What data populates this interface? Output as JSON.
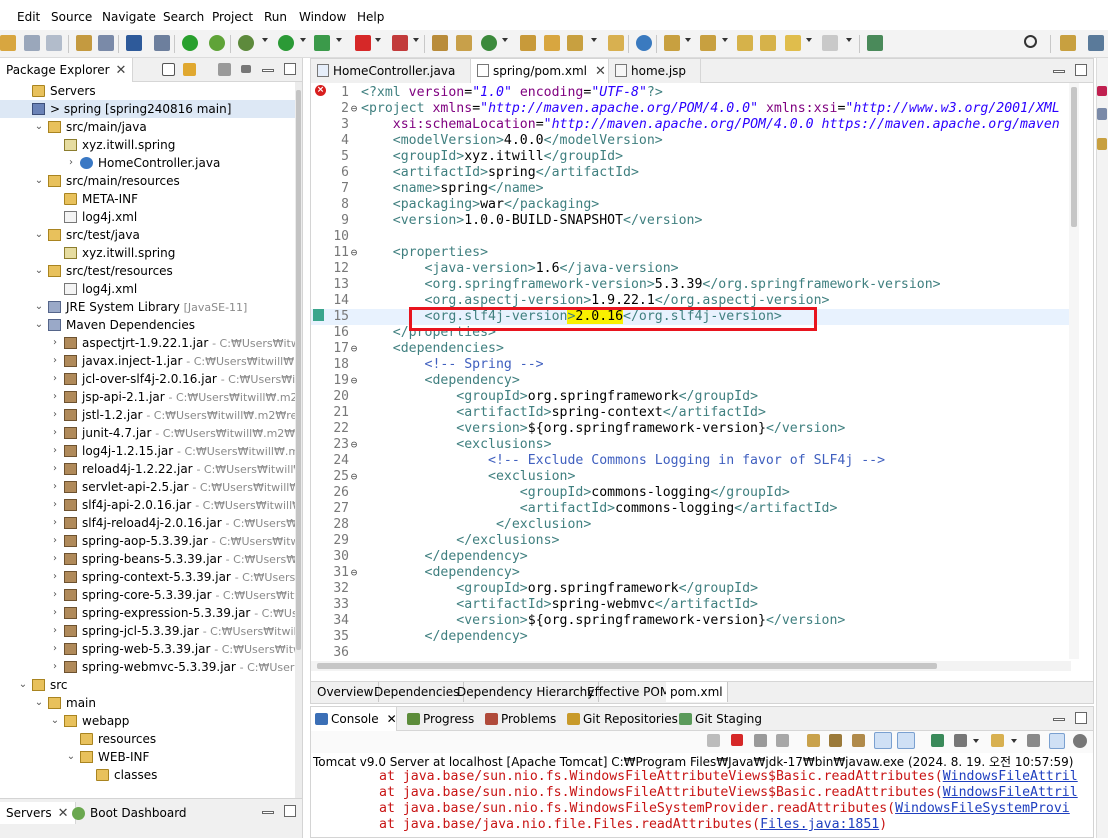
{
  "menu": [
    "Edit",
    "Source",
    "Navigate",
    "Search",
    "Project",
    "Run",
    "Window",
    "Help"
  ],
  "package_explorer": {
    "title": "Package Explorer",
    "rows": [
      {
        "label": "Servers",
        "path": "",
        "indent": 0,
        "icon": "folder"
      },
      {
        "label": "> spring [spring240816 main]",
        "path": "",
        "indent": 0,
        "icon": "project",
        "selected": true
      },
      {
        "label": "src/main/java",
        "path": "",
        "indent": 1,
        "icon": "src"
      },
      {
        "label": "xyz.itwill.spring",
        "path": "",
        "indent": 2,
        "icon": "pkg"
      },
      {
        "label": "HomeController.java",
        "path": "",
        "indent": 3,
        "icon": "java"
      },
      {
        "label": "src/main/resources",
        "path": "",
        "indent": 1,
        "icon": "src"
      },
      {
        "label": "META-INF",
        "path": "",
        "indent": 2,
        "icon": "folder"
      },
      {
        "label": "log4j.xml",
        "path": "",
        "indent": 2,
        "icon": "xml"
      },
      {
        "label": "src/test/java",
        "path": "",
        "indent": 1,
        "icon": "src"
      },
      {
        "label": "xyz.itwill.spring",
        "path": "",
        "indent": 2,
        "icon": "pkg"
      },
      {
        "label": "src/test/resources",
        "path": "",
        "indent": 1,
        "icon": "src"
      },
      {
        "label": "log4j.xml",
        "path": "",
        "indent": 2,
        "icon": "xml"
      },
      {
        "label": "JRE System Library",
        "path": "[JavaSE-11]",
        "indent": 1,
        "icon": "lib"
      },
      {
        "label": "Maven Dependencies",
        "path": "",
        "indent": 1,
        "icon": "lib"
      },
      {
        "label": "aspectjrt-1.9.22.1.jar",
        "path": "- C:₩Users₩itwill₩.m2₩",
        "indent": 2,
        "icon": "jar"
      },
      {
        "label": "javax.inject-1.jar",
        "path": "- C:₩Users₩itwill₩.m2₩repo",
        "indent": 2,
        "icon": "jar"
      },
      {
        "label": "jcl-over-slf4j-2.0.16.jar",
        "path": "- C:₩Users₩itwill₩.m",
        "indent": 2,
        "icon": "jar"
      },
      {
        "label": "jsp-api-2.1.jar",
        "path": "- C:₩Users₩itwill₩.m2₩repos",
        "indent": 2,
        "icon": "jar"
      },
      {
        "label": "jstl-1.2.jar",
        "path": "- C:₩Users₩itwill₩.m2₩repository",
        "indent": 2,
        "icon": "jar"
      },
      {
        "label": "junit-4.7.jar",
        "path": "- C:₩Users₩itwill₩.m2₩reposito",
        "indent": 2,
        "icon": "jar"
      },
      {
        "label": "log4j-1.2.15.jar",
        "path": "- C:₩Users₩itwill₩.m2₩repc",
        "indent": 2,
        "icon": "jar"
      },
      {
        "label": "reload4j-1.2.22.jar",
        "path": "- C:₩Users₩itwill₩.m2₩re",
        "indent": 2,
        "icon": "jar"
      },
      {
        "label": "servlet-api-2.5.jar",
        "path": "- C:₩Users₩itwill₩.m2₩re",
        "indent": 2,
        "icon": "jar"
      },
      {
        "label": "slf4j-api-2.0.16.jar",
        "path": "- C:₩Users₩itwill₩.m2₩re",
        "indent": 2,
        "icon": "jar"
      },
      {
        "label": "slf4j-reload4j-2.0.16.jar",
        "path": "- C:₩Users₩itwill₩.n",
        "indent": 2,
        "icon": "jar"
      },
      {
        "label": "spring-aop-5.3.39.jar",
        "path": "- C:₩Users₩itwill₩.m2",
        "indent": 2,
        "icon": "jar"
      },
      {
        "label": "spring-beans-5.3.39.jar",
        "path": "- C:₩Users₩itwill₩.m",
        "indent": 2,
        "icon": "jar"
      },
      {
        "label": "spring-context-5.3.39.jar",
        "path": "- C:₩Users₩itwill₩",
        "indent": 2,
        "icon": "jar"
      },
      {
        "label": "spring-core-5.3.39.jar",
        "path": "- C:₩Users₩itwill₩.m2",
        "indent": 2,
        "icon": "jar"
      },
      {
        "label": "spring-expression-5.3.39.jar",
        "path": "- C:₩Users₩itwi",
        "indent": 2,
        "icon": "jar"
      },
      {
        "label": "spring-jcl-5.3.39.jar",
        "path": "- C:₩Users₩itwill₩.m2₩",
        "indent": 2,
        "icon": "jar"
      },
      {
        "label": "spring-web-5.3.39.jar",
        "path": "- C:₩Users₩itwill₩.m2",
        "indent": 2,
        "icon": "jar"
      },
      {
        "label": "spring-webmvc-5.3.39.jar",
        "path": "- C:₩Users₩itwill₩",
        "indent": 2,
        "icon": "jar"
      },
      {
        "label": "src",
        "path": "",
        "indent": 0,
        "icon": "src"
      },
      {
        "label": "main",
        "path": "",
        "indent": 1,
        "icon": "src"
      },
      {
        "label": "webapp",
        "path": "",
        "indent": 2,
        "icon": "src"
      },
      {
        "label": "resources",
        "path": "",
        "indent": 3,
        "icon": "folder"
      },
      {
        "label": "WEB-INF",
        "path": "",
        "indent": 3,
        "icon": "src"
      },
      {
        "label": "classes",
        "path": "",
        "indent": 4,
        "icon": "folder"
      }
    ]
  },
  "servers_panel": {
    "servers_tab": "Servers",
    "boot_dashboard_tab": "Boot Dashboard"
  },
  "editor": {
    "tabs": [
      {
        "label": "HomeController.java",
        "active": false
      },
      {
        "label": "spring/pom.xml",
        "active": true
      },
      {
        "label": "home.jsp",
        "active": false
      }
    ],
    "current_line": 15,
    "lines": [
      {
        "n": "1",
        "fold": "",
        "html": "<span class=\"tag\">&lt;?xml</span> <span class=\"attr\">version</span>=<span class=\"str\">\"1.0\"</span> <span class=\"attr\">encoding</span>=<span class=\"str\">\"UTF-8\"</span><span class=\"tag\">?&gt;</span>"
      },
      {
        "n": "2",
        "fold": "⊖",
        "html": "<span class=\"tag\">&lt;project</span> <span class=\"attr\">xmlns</span>=<span class=\"str\">\"http://maven.apache.org/POM/4.0.0\"</span> <span class=\"attr\">xmlns:xsi</span>=<span class=\"str\">\"http://www.w3.org/2001/XML</span>"
      },
      {
        "n": "3",
        "fold": "",
        "html": "    <span class=\"attr\">xsi:schemaLocation</span>=<span class=\"str\">\"http://maven.apache.org/POM/4.0.0 https://maven.apache.org/maven</span>"
      },
      {
        "n": "4",
        "fold": "",
        "html": "    <span class=\"tag\">&lt;modelVersion&gt;</span>4.0.0<span class=\"tag\">&lt;/modelVersion&gt;</span>"
      },
      {
        "n": "5",
        "fold": "",
        "html": "    <span class=\"tag\">&lt;groupId&gt;</span>xyz.itwill<span class=\"tag\">&lt;/groupId&gt;</span>"
      },
      {
        "n": "6",
        "fold": "",
        "html": "    <span class=\"tag\">&lt;artifactId&gt;</span>spring<span class=\"tag\">&lt;/artifactId&gt;</span>"
      },
      {
        "n": "7",
        "fold": "",
        "html": "    <span class=\"tag\">&lt;name&gt;</span>spring<span class=\"tag\">&lt;/name&gt;</span>"
      },
      {
        "n": "8",
        "fold": "",
        "html": "    <span class=\"tag\">&lt;packaging&gt;</span>war<span class=\"tag\">&lt;/packaging&gt;</span>"
      },
      {
        "n": "9",
        "fold": "",
        "html": "    <span class=\"tag\">&lt;version&gt;</span>1.0.0-BUILD-SNAPSHOT<span class=\"tag\">&lt;/version&gt;</span>"
      },
      {
        "n": "10",
        "fold": "",
        "html": ""
      },
      {
        "n": "11",
        "fold": "⊖",
        "html": "    <span class=\"tag\">&lt;properties&gt;</span>"
      },
      {
        "n": "12",
        "fold": "",
        "html": "        <span class=\"tag\">&lt;java-version&gt;</span>1.6<span class=\"tag\">&lt;/java-version&gt;</span>"
      },
      {
        "n": "13",
        "fold": "",
        "html": "        <span class=\"tag\">&lt;org.springframework-version&gt;</span>5.3.39<span class=\"tag\">&lt;/org.springframework-version&gt;</span>"
      },
      {
        "n": "14",
        "fold": "",
        "html": "        <span class=\"tag\">&lt;org.aspectj-version&gt;</span>1.9.22.1<span class=\"tag\">&lt;/org.aspectj-version&gt;</span>"
      },
      {
        "n": "15",
        "fold": "",
        "html": "        <span class=\"tag\">&lt;org.slf4j-version</span><span class=\"hl\"><span class=\"tag\">&gt;</span>2.0.16</span><span class=\"tag\">&lt;/org.slf4j-version&gt;</span>"
      },
      {
        "n": "16",
        "fold": "",
        "html": "    <span class=\"tag\">&lt;/properties&gt;</span>"
      },
      {
        "n": "17",
        "fold": "⊖",
        "html": "    <span class=\"tag\">&lt;dependencies&gt;</span>"
      },
      {
        "n": "18",
        "fold": "",
        "html": "        <span class=\"cmt\">&lt;!-- Spring --&gt;</span>"
      },
      {
        "n": "19",
        "fold": "⊖",
        "html": "        <span class=\"tag\">&lt;dependency&gt;</span>"
      },
      {
        "n": "20",
        "fold": "",
        "html": "            <span class=\"tag\">&lt;groupId&gt;</span>org.springframework<span class=\"tag\">&lt;/groupId&gt;</span>"
      },
      {
        "n": "21",
        "fold": "",
        "html": "            <span class=\"tag\">&lt;artifactId&gt;</span>spring-context<span class=\"tag\">&lt;/artifactId&gt;</span>"
      },
      {
        "n": "22",
        "fold": "",
        "html": "            <span class=\"tag\">&lt;version&gt;</span>${org.springframework-version}<span class=\"tag\">&lt;/version&gt;</span>"
      },
      {
        "n": "23",
        "fold": "⊖",
        "html": "            <span class=\"tag\">&lt;exclusions&gt;</span>"
      },
      {
        "n": "24",
        "fold": "",
        "html": "                <span class=\"cmt\">&lt;!-- Exclude Commons Logging in favor of SLF4j --&gt;</span>"
      },
      {
        "n": "25",
        "fold": "⊖",
        "html": "                <span class=\"tag\">&lt;exclusion&gt;</span>"
      },
      {
        "n": "26",
        "fold": "",
        "html": "                    <span class=\"tag\">&lt;groupId&gt;</span>commons-logging<span class=\"tag\">&lt;/groupId&gt;</span>"
      },
      {
        "n": "27",
        "fold": "",
        "html": "                    <span class=\"tag\">&lt;artifactId&gt;</span>commons-logging<span class=\"tag\">&lt;/artifactId&gt;</span>"
      },
      {
        "n": "28",
        "fold": "",
        "html": "                 <span class=\"tag\">&lt;/exclusion&gt;</span>"
      },
      {
        "n": "29",
        "fold": "",
        "html": "            <span class=\"tag\">&lt;/exclusions&gt;</span>"
      },
      {
        "n": "30",
        "fold": "",
        "html": "        <span class=\"tag\">&lt;/dependency&gt;</span>"
      },
      {
        "n": "31",
        "fold": "⊖",
        "html": "        <span class=\"tag\">&lt;dependency&gt;</span>"
      },
      {
        "n": "32",
        "fold": "",
        "html": "            <span class=\"tag\">&lt;groupId&gt;</span>org.springframework<span class=\"tag\">&lt;/groupId&gt;</span>"
      },
      {
        "n": "33",
        "fold": "",
        "html": "            <span class=\"tag\">&lt;artifactId&gt;</span>spring-webmvc<span class=\"tag\">&lt;/artifactId&gt;</span>"
      },
      {
        "n": "34",
        "fold": "",
        "html": "            <span class=\"tag\">&lt;version&gt;</span>${org.springframework-version}<span class=\"tag\">&lt;/version&gt;</span>"
      },
      {
        "n": "35",
        "fold": "",
        "html": "        <span class=\"tag\">&lt;/dependency&gt;</span>"
      },
      {
        "n": "36",
        "fold": "",
        "html": ""
      }
    ],
    "subtabs": [
      "Overview",
      "Dependencies",
      "Dependency Hierarchy",
      "Effective POM",
      "pom.xml"
    ]
  },
  "console": {
    "tabs": [
      {
        "label": "Console",
        "active": true,
        "color": "#3b6fb6"
      },
      {
        "label": "Progress",
        "active": false,
        "color": "#5c8c3a"
      },
      {
        "label": "Problems",
        "active": false,
        "color": "#b04a3a"
      },
      {
        "label": "Git Repositories",
        "active": false,
        "color": "#c89a2a"
      },
      {
        "label": "Git Staging",
        "active": false,
        "color": "#5a9a5a"
      }
    ],
    "title": "Tomcat v9.0 Server at localhost [Apache Tomcat] C:₩Program Files₩Java₩jdk-17₩bin₩javaw.exe  (2024. 8. 19. 오전 10:57:59)",
    "lines": [
      {
        "prefix": "at java.base/sun.nio.fs.WindowsFileAttributeViews$Basic.readAttributes(",
        "link": "WindowsFileAttril"
      },
      {
        "prefix": "at java.base/sun.nio.fs.WindowsFileAttributeViews$Basic.readAttributes(",
        "link": "WindowsFileAttril"
      },
      {
        "prefix": "at java.base/sun.nio.fs.WindowsFileSystemProvider.readAttributes(",
        "link": "WindowsFileSystemProvi"
      },
      {
        "prefix": "at java.base/java.nio.file.Files.readAttributes(",
        "link": "Files.java:1851",
        "suffix": ")"
      }
    ]
  }
}
